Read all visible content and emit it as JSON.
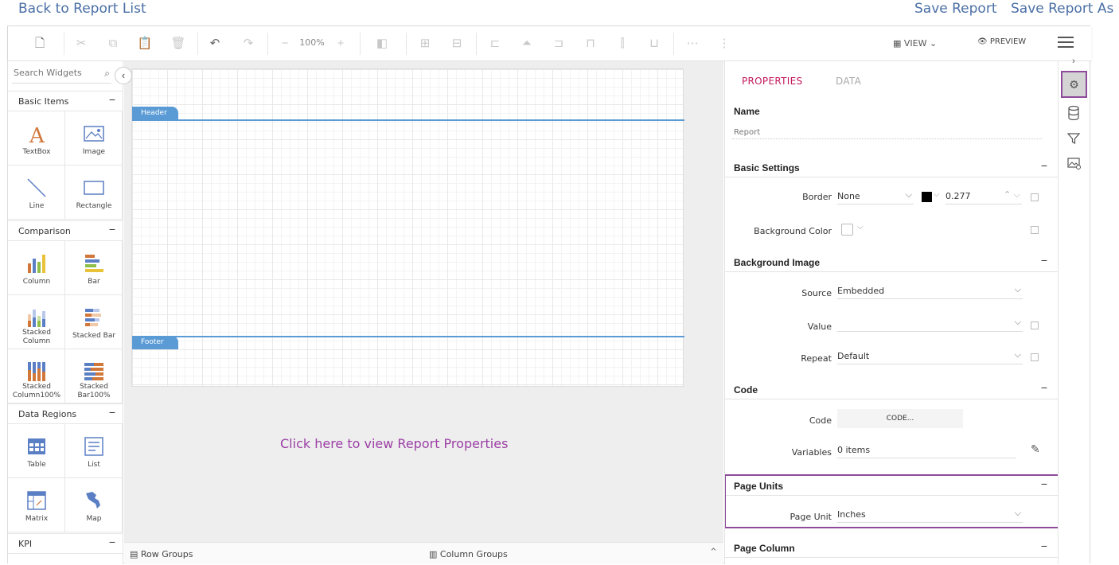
{
  "top_links": {
    "back": "Back to Report List",
    "save": "Save Report",
    "save_as": "Save Report As"
  },
  "toolbar": {
    "zoom": "100%",
    "view": "VIEW",
    "preview": "PREVIEW"
  },
  "widgets": {
    "search_placeholder": "Search Widgets",
    "categories": [
      {
        "label": "Basic Items",
        "items": [
          "TextBox",
          "Image",
          "Line",
          "Rectangle"
        ]
      },
      {
        "label": "Comparison",
        "items": [
          "Column",
          "Bar",
          "Stacked Column",
          "Stacked Bar",
          "Stacked Column100%",
          "Stacked Bar100%"
        ]
      },
      {
        "label": "Data Regions",
        "items": [
          "Table",
          "List",
          "Matrix",
          "Map"
        ]
      },
      {
        "label": "KPI",
        "items": []
      }
    ]
  },
  "canvas": {
    "header": "Header",
    "footer": "Footer",
    "link": "Click here to view Report Properties"
  },
  "groups": {
    "row": "Row Groups",
    "column": "Column Groups"
  },
  "properties": {
    "tabs": {
      "properties": "PROPERTIES",
      "data": "DATA"
    },
    "name": {
      "label": "Name",
      "placeholder": "Report"
    },
    "basic_settings": {
      "title": "Basic Settings",
      "border_label": "Border",
      "border_value": "None",
      "border_width": "0.277",
      "border_color": "#000000",
      "bg_label": "Background Color"
    },
    "background_image": {
      "title": "Background Image",
      "source_label": "Source",
      "source_value": "Embedded",
      "value_label": "Value",
      "value_value": "",
      "repeat_label": "Repeat",
      "repeat_value": "Default"
    },
    "code": {
      "title": "Code",
      "code_label": "Code",
      "code_button": "CODE...",
      "variables_label": "Variables",
      "variables_value": "0 items"
    },
    "page_units": {
      "title": "Page Units",
      "unit_label": "Page Unit",
      "unit_value": "Inches"
    },
    "page_column": {
      "title": "Page Column"
    }
  },
  "colors": {
    "accent": "#c2185b",
    "highlight": "#8e4a9b",
    "band": "#5b9bd5",
    "link": "#4a6fa5"
  }
}
